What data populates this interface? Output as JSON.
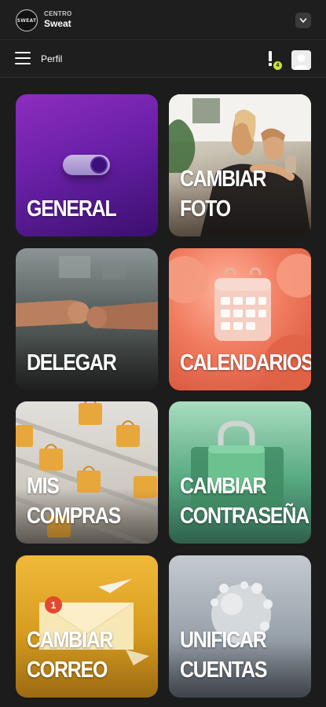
{
  "header": {
    "logo_text": "SWEAT",
    "brand_subtitle": "CENTRO",
    "brand_name": "Sweat"
  },
  "navbar": {
    "title": "Perfil",
    "notification_count": "4",
    "badge_color": "#c7e437"
  },
  "tiles": [
    {
      "label": "GENERAL",
      "icon": "toggle-switch"
    },
    {
      "label": "CAMBIAR FOTO",
      "icon": "selfie-photo"
    },
    {
      "label": "DELEGAR",
      "icon": "fist-bump"
    },
    {
      "label": "CALENDARIOS",
      "icon": "calendar"
    },
    {
      "label": "MIS COMPRAS",
      "icon": "shopping-bags"
    },
    {
      "label": "CAMBIAR\nCONTRASEÑA",
      "icon": "padlock"
    },
    {
      "label": "CAMBIAR\nCORREO",
      "icon": "envelope",
      "badge": "1"
    },
    {
      "label": "UNIFICAR\nCUENTAS",
      "icon": "merge-spheres"
    }
  ],
  "colors": {
    "background": "#1c1c1c",
    "general_tile": "#7a25b3",
    "calendar_tile": "#f07b5f",
    "password_tile": "#57a982",
    "email_tile": "#e0a52a"
  }
}
